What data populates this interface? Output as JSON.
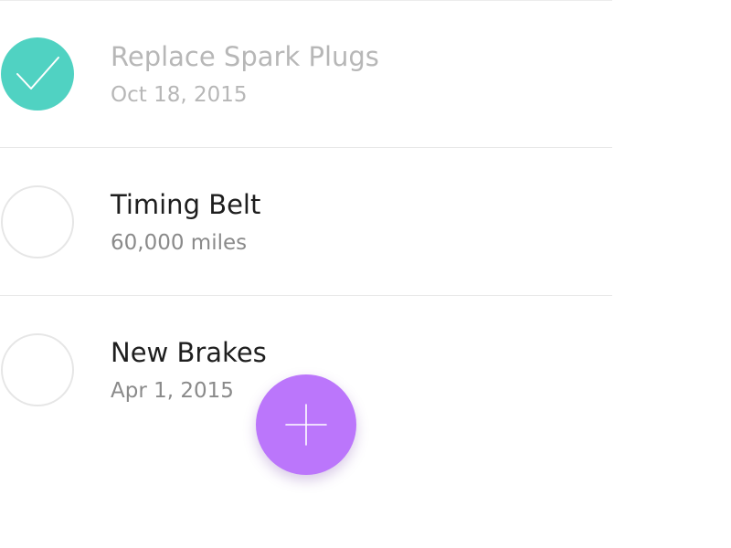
{
  "tasks": [
    {
      "title": "Replace Spark Plugs",
      "subtitle": "Oct 18, 2015",
      "completed": true
    },
    {
      "title": "Timing Belt",
      "subtitle": "60,000 miles",
      "completed": false
    },
    {
      "title": "New Brakes",
      "subtitle": "Apr 1, 2015",
      "completed": false
    }
  ],
  "icons": {
    "checkmark": "checkmark-icon",
    "add": "plus-icon"
  },
  "colors": {
    "completed_accent": "#50d2c2",
    "fab": "#bb76fb",
    "title_text": "#1e1e1e",
    "subtitle_text": "#8a8a8a",
    "completed_text": "#b7b7b7",
    "divider": "#e8e8e8"
  }
}
